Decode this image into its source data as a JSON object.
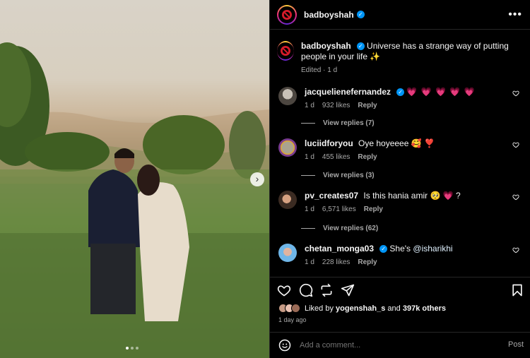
{
  "post": {
    "username": "badboyshah",
    "caption": "Universe has a strange way of putting people in your life",
    "caption_emoji": "✨",
    "caption_meta": "Edited · 1 d",
    "slide_count": 3,
    "active_slide": 1
  },
  "comments": [
    {
      "user": "jacquelienefernandez",
      "verified": true,
      "text": "",
      "emoji": "💗 💗 💗 💗 💗",
      "time": "1 d",
      "likes": "932 likes",
      "reply": "Reply",
      "view_replies": "View replies (7)"
    },
    {
      "user": "luciidforyou",
      "verified": false,
      "text": "Oye hoyeeee",
      "emoji": "🥰 ❣️",
      "time": "1 d",
      "likes": "455 likes",
      "reply": "Reply",
      "view_replies": "View replies (3)"
    },
    {
      "user": "pv_creates07",
      "verified": false,
      "text": "Is this hania amir",
      "emoji": "🥺 💗 ?",
      "time": "1 d",
      "likes": "6,571 likes",
      "reply": "Reply",
      "view_replies": "View replies (62)"
    },
    {
      "user": "chetan_monga03",
      "verified": true,
      "text": "She's",
      "mention": "@isharikhi",
      "time": "1 d",
      "likes": "228 likes",
      "reply": "Reply"
    }
  ],
  "likes": {
    "prefix": "Liked by",
    "user": "yogenshah_s",
    "and": "and",
    "others": "397k others"
  },
  "ago": "1 day ago",
  "add_comment": {
    "placeholder": "Add a comment...",
    "post_label": "Post"
  },
  "colors": {
    "verified": "#0095f6",
    "bg": "#000000",
    "muted": "#a8a8a8"
  },
  "icons": [
    "heart-icon",
    "comment-icon",
    "repost-icon",
    "share-icon",
    "save-icon",
    "emoji-icon",
    "more-icon",
    "next-arrow-icon"
  ]
}
